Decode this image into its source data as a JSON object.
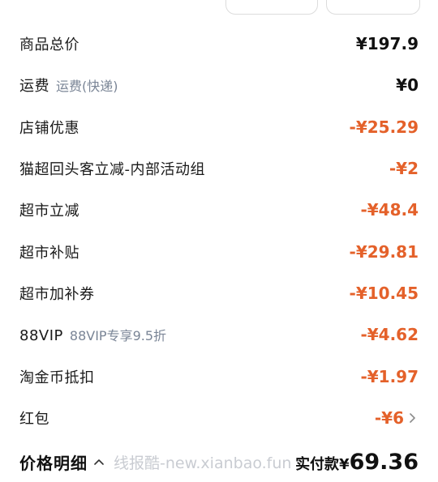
{
  "price_detail": {
    "rows": [
      {
        "label": "商品总价",
        "amount": "¥197.9"
      },
      {
        "label": "运费",
        "sub": "运费(快递)",
        "amount": "¥0"
      },
      {
        "label": "店铺优惠",
        "amount": "-¥25.29"
      },
      {
        "label": "猫超回头客立减-内部活动组",
        "amount": "-¥2"
      },
      {
        "label": "超市立减",
        "amount": "-¥48.4"
      },
      {
        "label": "超市补贴",
        "amount": "-¥29.81"
      },
      {
        "label": "超市加补券",
        "amount": "-¥10.45"
      },
      {
        "label": "88VIP",
        "sub": "88VIP专享9.5折",
        "amount": "-¥4.62"
      },
      {
        "label": "淘金币抵扣",
        "amount": "-¥1.97"
      },
      {
        "label": "红包",
        "amount": "-¥6"
      }
    ]
  },
  "footer": {
    "title": "价格明细",
    "watermark": "线报酷-new.xianbao.fun",
    "paid_label": "实付款",
    "paid_currency": "¥",
    "paid_value": "69.36"
  },
  "colors": {
    "discount": "#e4612a",
    "text": "#111111",
    "subtext": "#7a8596"
  },
  "icons": {
    "footer_toggle": "chevron-up-icon",
    "red_packet_arrow": "chevron-right-icon"
  }
}
